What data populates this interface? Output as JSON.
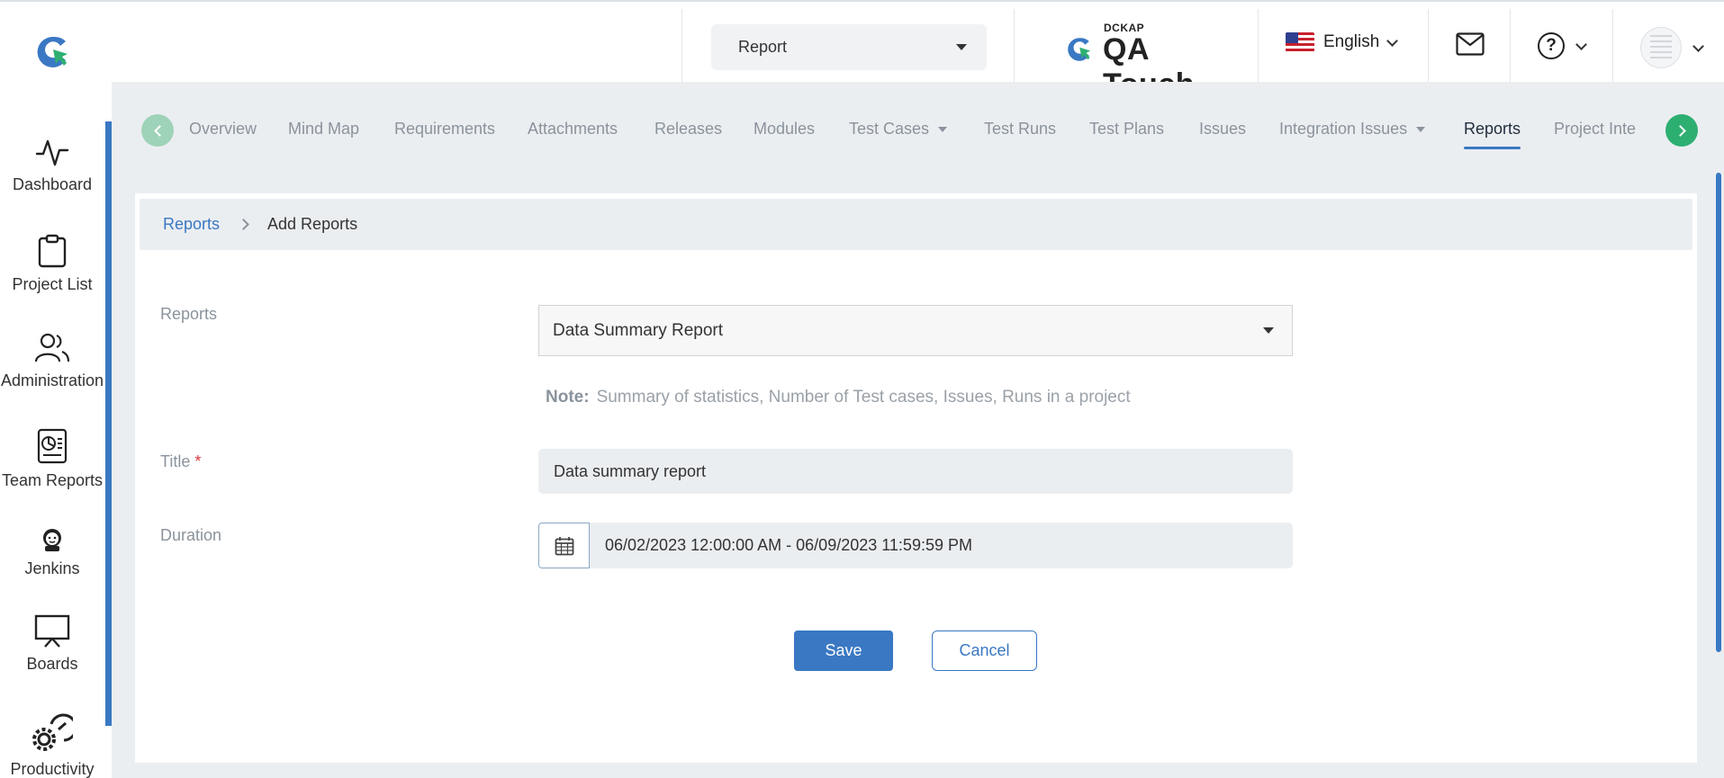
{
  "header": {
    "module_select": "Report",
    "brand_small": "DCKAP",
    "brand_name": "QA Touch",
    "language": "English",
    "icons": [
      "qatouch-logo-icon",
      "flag-us-icon",
      "mail-icon",
      "help-icon",
      "avatar-icon"
    ]
  },
  "sidebar": {
    "items": [
      {
        "label": "Dashboard",
        "icon": "activity-icon"
      },
      {
        "label": "Project List",
        "icon": "clipboard-icon"
      },
      {
        "label": "Administration",
        "icon": "users-icon"
      },
      {
        "label": "Team Reports",
        "icon": "report-icon"
      },
      {
        "label": "Jenkins",
        "icon": "jenkins-icon"
      },
      {
        "label": "Boards",
        "icon": "presentation-board-icon"
      },
      {
        "label": "Productivity",
        "icon": "gear-gauge-icon"
      }
    ]
  },
  "tabs": {
    "items": [
      {
        "label": "Overview"
      },
      {
        "label": "Mind Map"
      },
      {
        "label": "Requirements"
      },
      {
        "label": "Attachments"
      },
      {
        "label": "Releases"
      },
      {
        "label": "Modules"
      },
      {
        "label": "Test Cases"
      },
      {
        "label": "Test Runs"
      },
      {
        "label": "Test Plans"
      },
      {
        "label": "Issues"
      },
      {
        "label": "Integration Issues"
      },
      {
        "label": "Reports"
      },
      {
        "label": "Project Inte"
      }
    ],
    "active": "Reports"
  },
  "breadcrumb": {
    "parent": "Reports",
    "current": "Add Reports"
  },
  "form": {
    "reports_label": "Reports",
    "reports_value": "Data Summary Report",
    "note_label": "Note:",
    "note_text": "Summary of statistics, Number of Test cases, Issues, Runs in a project",
    "title_label": "Title",
    "required_mark": "*",
    "title_value": "Data summary report",
    "duration_label": "Duration",
    "duration_value": "06/02/2023 12:00:00 AM - 06/09/2023 11:59:59 PM",
    "save_label": "Save",
    "cancel_label": "Cancel"
  },
  "colors": {
    "accent": "#3a78c3",
    "tab_next": "#2eaf72",
    "tab_prev": "#9fd3b9",
    "required": "#d9363e",
    "content_bg": "#ebeef1"
  }
}
